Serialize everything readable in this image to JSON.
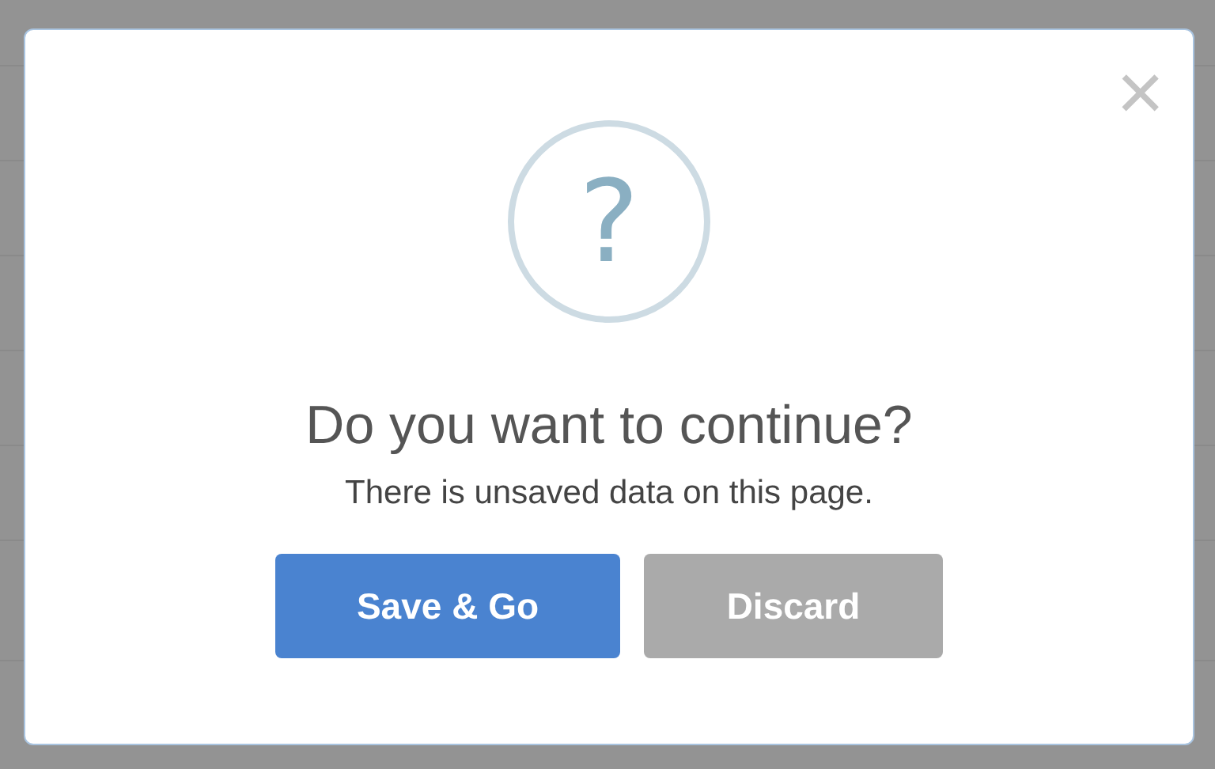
{
  "dialog": {
    "close": "×",
    "icon": "?",
    "title": "Do you want to continue?",
    "message": "There is unsaved data on this page.",
    "buttons": [
      {
        "label": "Save & Go",
        "kind": "primary"
      },
      {
        "label": "Discard",
        "kind": "secondary"
      }
    ]
  }
}
